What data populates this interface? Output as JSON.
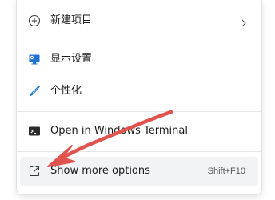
{
  "menu": {
    "items": [
      {
        "label": "新建项目",
        "icon": "plus-circle-icon",
        "has_submenu": true
      },
      {
        "label": "显示设置",
        "icon": "display-settings-icon"
      },
      {
        "label": "个性化",
        "icon": "brush-icon"
      },
      {
        "label": "Open in Windows Terminal",
        "icon": "terminal-icon"
      },
      {
        "label": "Show more options",
        "icon": "expand-icon",
        "shortcut": "Shift+F10"
      }
    ]
  },
  "colors": {
    "annotation_arrow": "#e0524c",
    "icon_blue": "#1e74d2",
    "hover_bg": "#f2f3f5"
  }
}
